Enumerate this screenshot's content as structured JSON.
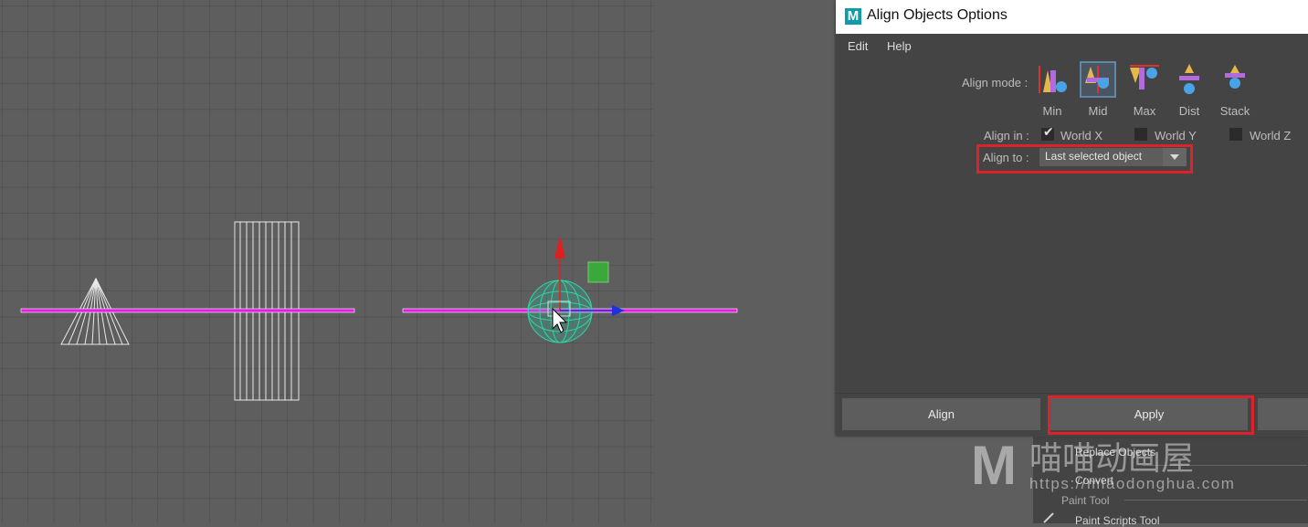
{
  "window": {
    "title": "Align Objects Options",
    "app_logo": "M",
    "menu": [
      "Edit",
      "Help"
    ]
  },
  "options": {
    "align_mode_label": "Align mode :",
    "modes": [
      {
        "label": "Min",
        "icon": "align-min-icon",
        "selected": false
      },
      {
        "label": "Mid",
        "icon": "align-mid-icon",
        "selected": true
      },
      {
        "label": "Max",
        "icon": "align-max-icon",
        "selected": false
      },
      {
        "label": "Dist",
        "icon": "align-dist-icon",
        "selected": false
      },
      {
        "label": "Stack",
        "icon": "align-stack-icon",
        "selected": false
      }
    ],
    "align_in_label": "Align in :",
    "axes": [
      {
        "label": "World X",
        "checked": true
      },
      {
        "label": "World Y",
        "checked": false
      },
      {
        "label": "World Z",
        "checked": false
      }
    ],
    "align_to_label": "Align to :",
    "align_to_value": "Last selected object"
  },
  "buttons": {
    "align": "Align",
    "apply": "Apply"
  },
  "background_menu": {
    "items": [
      "Replace Objects",
      "Convert",
      "Paint Tool",
      "Paint Scripts Tool"
    ]
  },
  "watermark": {
    "letter": "M",
    "chinese": "喵喵动画屋",
    "url": "https://miaodonghua.com"
  },
  "colors": {
    "highlight": "#e0202a",
    "selection_line": "#e020e0",
    "selected_object": "#2fd4a8",
    "title_accent": "#0f9ca8"
  }
}
